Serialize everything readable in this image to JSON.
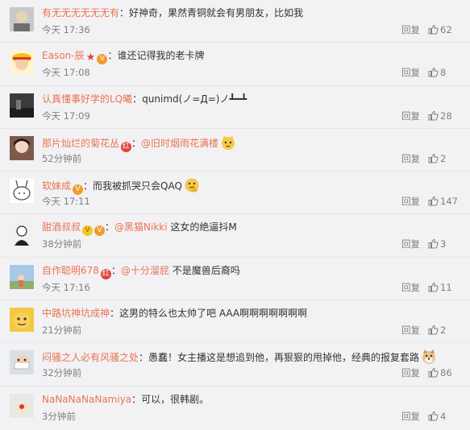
{
  "labels": {
    "reply": "回复"
  },
  "colors": {
    "username": "#eb7350",
    "meta": "#808080",
    "background": "#f2f2f5"
  },
  "comments": [
    {
      "user": "有无无无无无无有",
      "badges": [],
      "sep": "：",
      "mention": "",
      "text": "好神奇，果然青铜就会有男朋友，比如我",
      "emoji": "",
      "time": "今天 17:36",
      "likes": "62"
    },
    {
      "user": "Eason-辰",
      "badges": [
        "star",
        "vip"
      ],
      "sep": "：",
      "mention": "",
      "text": "谁还记得我的老卡牌",
      "emoji": "",
      "time": "今天 17:08",
      "likes": "8"
    },
    {
      "user": "认真懂事好学的LQ曦",
      "badges": [],
      "sep": "：",
      "mention": "",
      "text": "qunimd(ノ=Д=)ノ┻━┻",
      "emoji": "",
      "time": "今天 17:09",
      "likes": "28"
    },
    {
      "user": "那片灿烂的菊花丛",
      "badges": [
        "red"
      ],
      "sep": "：",
      "mention": "@旧时烟雨花满楼",
      "text": "",
      "emoji": "cat-emoji",
      "time": "52分钟前",
      "likes": "2"
    },
    {
      "user": "软妹成",
      "badges": [
        "vip"
      ],
      "sep": "：",
      "mention": "",
      "text": "而我被抓哭只会QAQ",
      "emoji": "thinking-emoji",
      "time": "今天 17:11",
      "likes": "147"
    },
    {
      "user": "甜酒叔叔",
      "badges": [
        "v",
        "vip"
      ],
      "sep": "：",
      "mention": "@黑猫Nikki",
      "text": " 这女的绝逼抖M",
      "emoji": "",
      "time": "38分钟前",
      "likes": "3"
    },
    {
      "user": "自作聪明678",
      "badges": [
        "red"
      ],
      "sep": "：",
      "mention": "@十分溜屁",
      "text": " 不是魔兽后裔吗",
      "emoji": "",
      "time": "今天 17:16",
      "likes": "11"
    },
    {
      "user": "中路坑神坑成神",
      "badges": [],
      "sep": "：",
      "mention": "",
      "text": "这男的特么也太帅了吧 AAA啊啊啊啊啊啊啊",
      "emoji": "",
      "time": "21分钟前",
      "likes": "2"
    },
    {
      "user": "闷骚之人必有风骚之处",
      "badges": [],
      "sep": "：",
      "mention": "",
      "text": "愚蠢！女主播这是想追到他，再狠狠的甩掉他，经典的报复套路",
      "emoji": "doge-emoji",
      "time": "32分钟前",
      "likes": "86"
    },
    {
      "user": "NaNaNaNaNamiya",
      "badges": [],
      "sep": "：",
      "mention": "",
      "text": "可以，很韩剧。",
      "emoji": "",
      "time": "3分钟前",
      "likes": "4"
    }
  ]
}
